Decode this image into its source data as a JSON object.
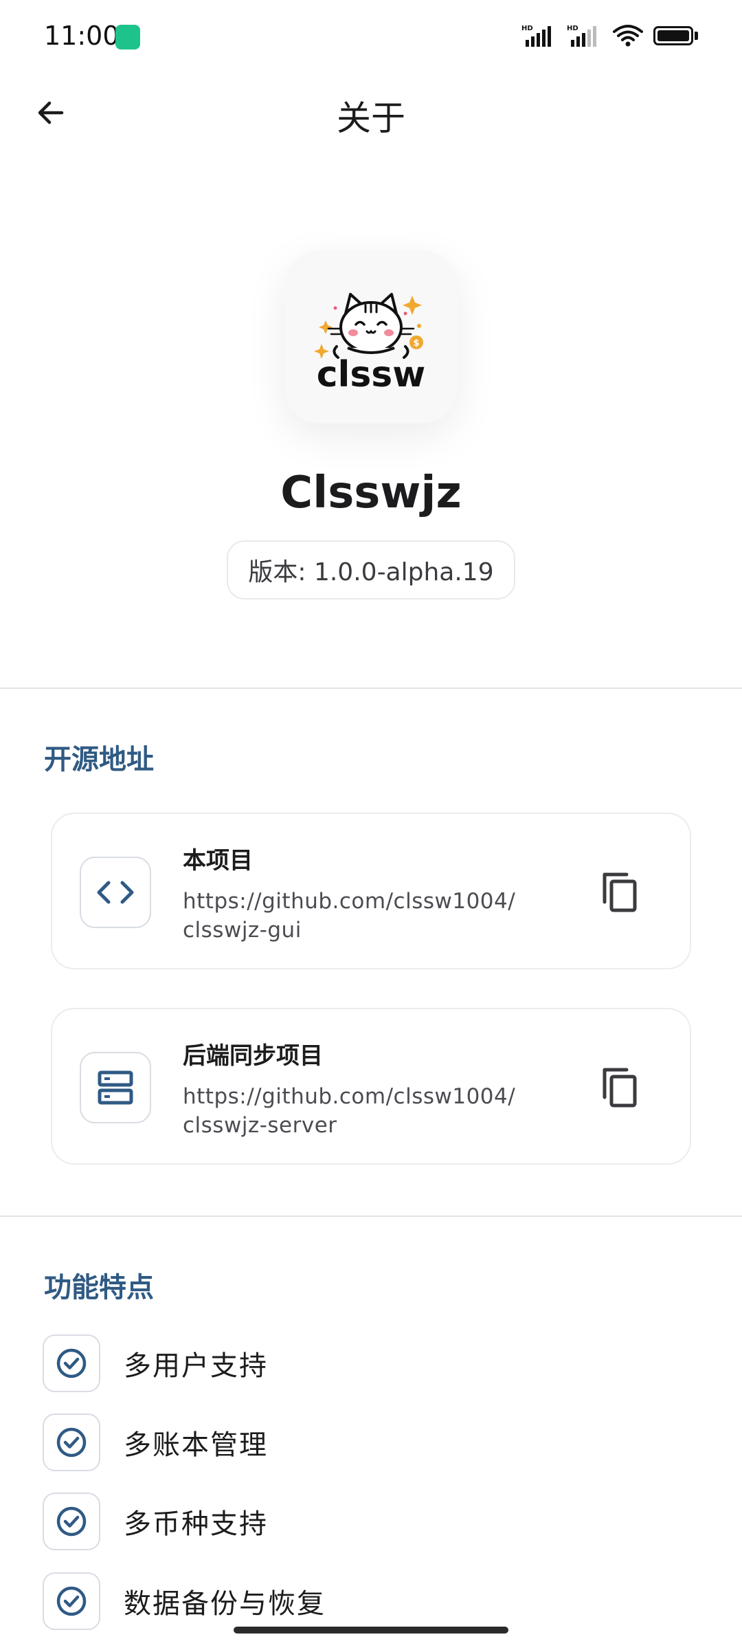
{
  "status_bar": {
    "time": "11:00",
    "icons": [
      "app-notification-icon",
      "hd-signal-icon",
      "hd-signal-icon",
      "wifi-icon",
      "battery-icon"
    ]
  },
  "app_bar": {
    "title": "关于",
    "back_icon": "arrow-left-icon"
  },
  "header": {
    "logo_text": "clssw",
    "app_name": "Clsswjz",
    "version": "版本: 1.0.0-alpha.19"
  },
  "open_source": {
    "section_title": "开源地址",
    "repos": [
      {
        "name": "本项目",
        "url_line1": "https://github.com/clssw1004/",
        "url_line2": "clsswjz-gui",
        "icon": "code-icon"
      },
      {
        "name": "后端同步项目",
        "url_line1": "https://github.com/clssw1004/",
        "url_line2": "clsswjz-server",
        "icon": "server-icon"
      }
    ]
  },
  "features": {
    "section_title": "功能特点",
    "items": [
      {
        "label": "多用户支持"
      },
      {
        "label": "多账本管理"
      },
      {
        "label": "多币种支持"
      },
      {
        "label": "数据备份与恢复"
      }
    ]
  },
  "colors": {
    "accent": "#2f5a84",
    "status_app_icon": "#1ec38b",
    "border": "#ececf0"
  }
}
